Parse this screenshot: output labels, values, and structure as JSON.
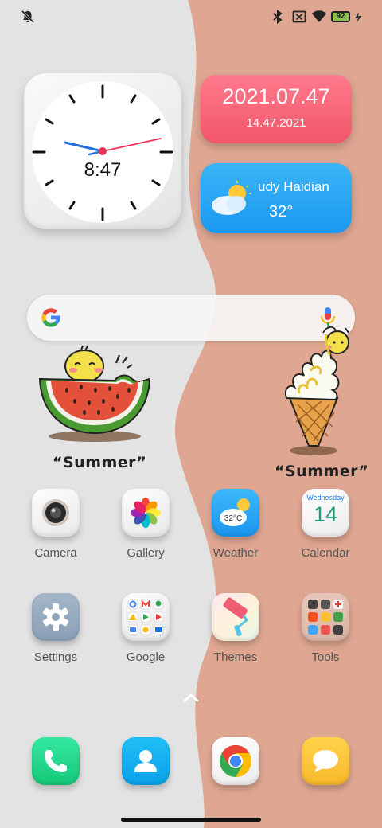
{
  "status_bar": {
    "battery_level": "92"
  },
  "clock_widget": {
    "time": "8:47"
  },
  "date_widget": {
    "date_main": "2021.07.47",
    "date_sub": "14.47.2021"
  },
  "weather_widget": {
    "marquee": "udy  Haidian",
    "temperature": "32°"
  },
  "stickers": {
    "left_caption": "“Summer”",
    "right_caption": "“Summer”"
  },
  "apps": [
    {
      "label": "Camera"
    },
    {
      "label": "Gallery"
    },
    {
      "label": "Weather",
      "icon_text": "32°C"
    },
    {
      "label": "Calendar",
      "weekday": "Wednesday",
      "day": "14"
    },
    {
      "label": "Settings"
    },
    {
      "label": "Google"
    },
    {
      "label": "Themes"
    },
    {
      "label": "Tools"
    }
  ],
  "colors": {
    "wallpaper_left": "#e3e3e3",
    "wallpaper_right": "#dfa792",
    "date_widget": "#f5606f",
    "weather_widget": "#27a8f5"
  }
}
